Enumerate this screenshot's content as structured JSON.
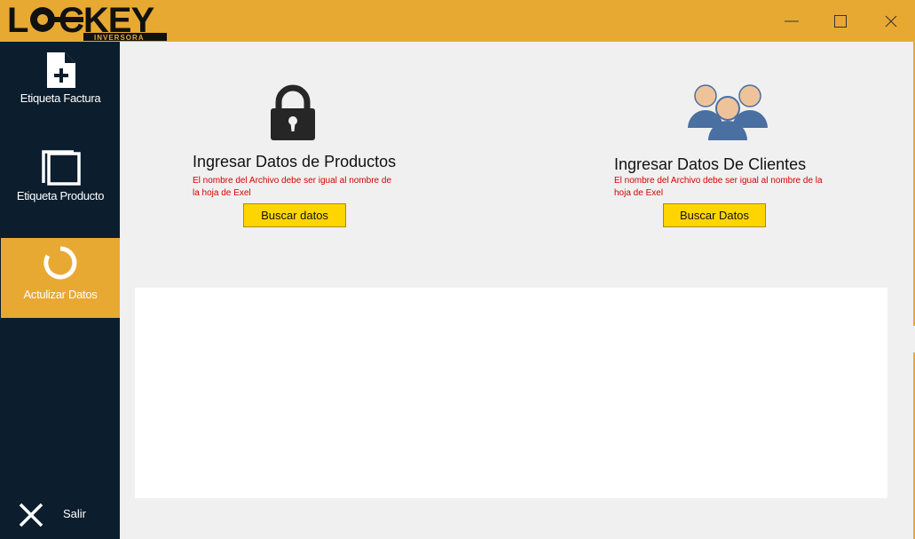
{
  "app": {
    "logo_text": "LOCKEY",
    "logo_subtext": "INVERSORA"
  },
  "window_controls": {
    "minimize_icon": "minimize-icon",
    "maximize_icon": "maximize-icon",
    "close_icon": "close-icon"
  },
  "sidebar": {
    "items": [
      {
        "label": "Etiqueta Factura",
        "icon": "add-document-icon",
        "active": false
      },
      {
        "label": "Etiqueta Producto",
        "icon": "copy-icon",
        "active": false
      },
      {
        "label": "Actulizar Datos",
        "icon": "refresh-ring-icon",
        "active": true
      }
    ],
    "exit_label": "Salir",
    "exit_icon": "close-x-icon"
  },
  "productos": {
    "title": "Ingresar Datos de Productos",
    "note": "El nombre del Archivo debe ser igual al nombre de la hoja de Exel",
    "button_label": "Buscar datos",
    "icon": "padlock-icon"
  },
  "clientes": {
    "title": "Ingresar Datos De Clientes",
    "note": "El nombre del Archivo debe ser igual al nombre de la hoja de Exel",
    "button_label": "Buscar Datos",
    "icon": "users-group-icon"
  },
  "colors": {
    "accent": "#e8a933",
    "sidebar": "#0c1e2e",
    "button": "#ffd500",
    "warning_text": "#d40000"
  }
}
